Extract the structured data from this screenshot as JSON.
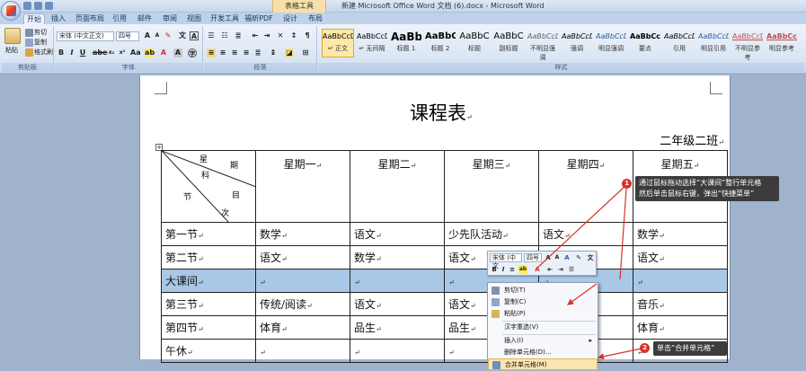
{
  "window": {
    "title": "新建 Microsoft Office Word 文档 (6).docx - Microsoft Word",
    "context_tab_title": "表格工具"
  },
  "tabs": [
    "开始",
    "插入",
    "页面布局",
    "引用",
    "邮件",
    "审阅",
    "视图",
    "开发工具",
    "福昕PDF",
    "设计",
    "布局"
  ],
  "active_tab": "开始",
  "clipboard": {
    "paste": "粘贴",
    "cut": "剪切",
    "copy": "复制",
    "format_painter": "格式刷",
    "label": "剪贴板"
  },
  "font": {
    "name": "宋体 (中文正文)",
    "size": "四号",
    "label": "字体"
  },
  "paragraph": {
    "label": "段落"
  },
  "styles": {
    "label": "样式",
    "items": [
      {
        "preview": "AaBbCcDd",
        "name": "↵ 正文"
      },
      {
        "preview": "AaBbCcDd",
        "name": "↵ 无间隔"
      },
      {
        "preview": "AaBb",
        "name": "标题 1"
      },
      {
        "preview": "AaBbC",
        "name": "标题 2"
      },
      {
        "preview": "AaBbC",
        "name": "标题"
      },
      {
        "preview": "AaBbC",
        "name": "副标题"
      },
      {
        "preview": "AaBbCcDd",
        "name": "不明显强调"
      },
      {
        "preview": "AaBbCcDd",
        "name": "强调"
      },
      {
        "preview": "AaBbCcDd",
        "name": "明显强调"
      },
      {
        "preview": "AaBbCcDd",
        "name": "要点"
      },
      {
        "preview": "AaBbCcDd",
        "name": "引用"
      },
      {
        "preview": "AaBbCcDd",
        "name": "明显引用"
      },
      {
        "preview": "AaBbCcDd",
        "name": "不明显参考"
      },
      {
        "preview": "AaBbCcDd",
        "name": "明显参考"
      }
    ]
  },
  "document": {
    "title": "课程表",
    "subtitle": "二年级二班",
    "diag_header": {
      "day_1": "星",
      "day_2": "期",
      "subject": "科",
      "period_1": "节",
      "period_2": "目",
      "period_3": "次"
    },
    "columns": [
      "星期一",
      "星期二",
      "星期三",
      "星期四",
      "星期五"
    ],
    "rows": [
      {
        "label": "第一节",
        "cells": [
          "数学",
          "语文",
          "少先队活动",
          "语文",
          "数学"
        ]
      },
      {
        "label": "第二节",
        "cells": [
          "语文",
          "数学",
          "语文",
          "",
          "语文"
        ]
      },
      {
        "label": "大课间",
        "cells": [
          "",
          "",
          "",
          "",
          ""
        ]
      },
      {
        "label": "第三节",
        "cells": [
          "传统/阅读",
          "语文",
          "语文",
          "",
          "音乐"
        ]
      },
      {
        "label": "第四节",
        "cells": [
          "体育",
          "品生",
          "品生",
          "",
          "体育"
        ]
      },
      {
        "label": "午休",
        "cells": [
          "",
          "",
          "",
          "",
          ""
        ]
      }
    ]
  },
  "mini_toolbar": {
    "font": "宋体 (中文",
    "size": "四号"
  },
  "context_menu": [
    {
      "label": "剪切(T)",
      "icon": "scissors-icon"
    },
    {
      "label": "复制(C)",
      "icon": "copy-icon"
    },
    {
      "label": "粘贴(P)",
      "icon": "paste-icon"
    },
    {
      "label": "汉字重选(V)",
      "icon": ""
    },
    {
      "label": "插入(I)",
      "icon": ""
    },
    {
      "label": "删除单元格(D)...",
      "icon": ""
    },
    {
      "label": "合并单元格(M)",
      "icon": "merge-icon"
    }
  ],
  "callouts": [
    {
      "num": "1",
      "text_1": "通过鼠标拖动选择“大课间”整行单元格",
      "text_2": "然后单击鼠标右键，弹出“快捷菜单”"
    },
    {
      "num": "2",
      "text_1": "单击“合并单元格”"
    }
  ],
  "colors": {
    "ribbon": "#dbe6f4",
    "selection": "#a9c7e6",
    "callout_bg": "#3c3c3c",
    "badge": "#d8322a",
    "arrow": "#d8322a"
  }
}
